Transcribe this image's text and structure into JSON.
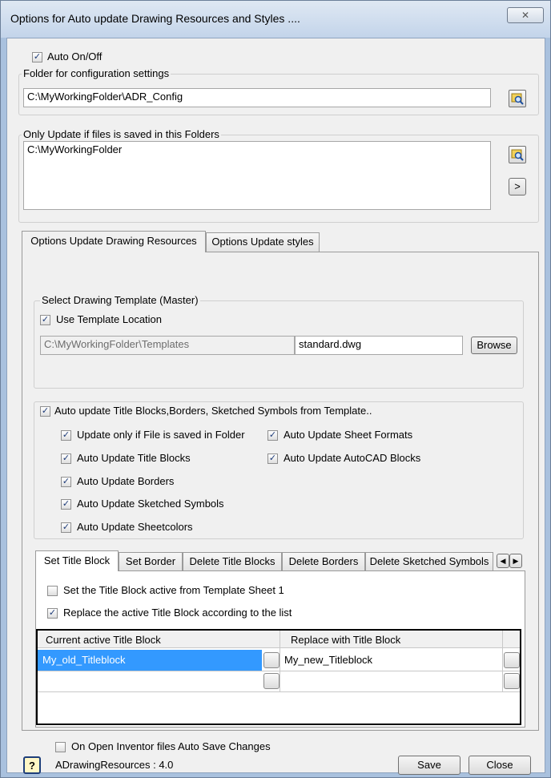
{
  "window": {
    "title": "Options for Auto  update Drawing Resources and Styles ....",
    "close_glyph": "✕"
  },
  "auto_onoff": {
    "label": "Auto On/Off",
    "checked": true
  },
  "config_folder": {
    "title": "Folder for configuration settings",
    "value": "C:\\MyWorkingFolder\\ADR_Config"
  },
  "update_folders": {
    "title": "Only Update if files is saved in this Folders",
    "value": "C:\\MyWorkingFolder",
    "arrow_label": ">"
  },
  "main_tabs": [
    {
      "label": "Options Update Drawing Resources"
    },
    {
      "label": "Options Update styles"
    }
  ],
  "template": {
    "group_title": "Select Drawing Template (Master)",
    "use_location_label": "Use Template Location",
    "location_value": "C:\\MyWorkingFolder\\Templates",
    "file_value": "standard.dwg",
    "browse_label": "Browse"
  },
  "auto_update": {
    "main_label": "Auto update Title Blocks,Borders, Sketched Symbols from Template..",
    "options": [
      {
        "label": "Update only if File is saved in Folder"
      },
      {
        "label": "Auto Update Title Blocks"
      },
      {
        "label": "Auto Update Borders"
      },
      {
        "label": "Auto Update Sketched Symbols"
      },
      {
        "label": "Auto Update Sheetcolors"
      },
      {
        "label": "Auto Update Sheet Formats"
      },
      {
        "label": "Auto Update AutoCAD Blocks"
      }
    ]
  },
  "sub_tabs": [
    {
      "label": "Set Title Block"
    },
    {
      "label": "Set Border"
    },
    {
      "label": "Delete Title Blocks"
    },
    {
      "label": "Delete Borders"
    },
    {
      "label": "Delete Sketched Symbols"
    }
  ],
  "title_block": {
    "set_active_label": "Set the Title Block active  from Template Sheet 1",
    "replace_label": "Replace the active Title Block according to the list",
    "columns": [
      "Current active Title Block",
      "Replace with Title Block"
    ],
    "rows": [
      {
        "current": "My_old_Titleblock",
        "replace": "My_new_Titleblock"
      },
      {
        "current": "",
        "replace": ""
      }
    ]
  },
  "footer": {
    "auto_save_label": "On Open Inventor files Auto Save Changes",
    "version_label": "ADrawingResources : 4.0",
    "help_glyph": "?",
    "save_label": "Save",
    "close_label": "Close"
  }
}
